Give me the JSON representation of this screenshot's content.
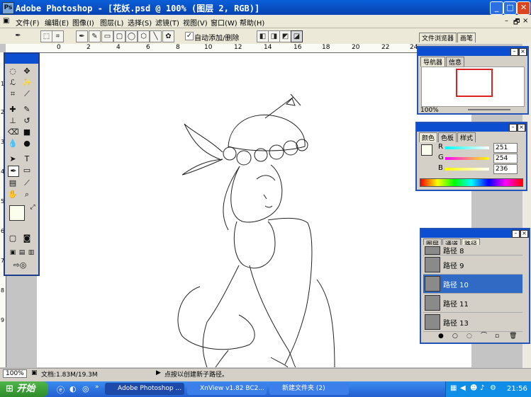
{
  "window": {
    "title": "Adobe Photoshop - [花妖.psd @ 100% (图层 2, RGB)]"
  },
  "menu": [
    "文件(F)",
    "编辑(E)",
    "图像(I)",
    "图层(L)",
    "选择(S)",
    "滤镜(T)",
    "视图(V)",
    "窗口(W)",
    "帮助(H)"
  ],
  "options": {
    "auto_add_delete": "自动添加/删除",
    "palette_tabs": [
      "文件浏览器",
      "画笔"
    ]
  },
  "ruler_ticks": [
    "0",
    "2",
    "4",
    "6",
    "8",
    "10",
    "12",
    "14",
    "16",
    "18",
    "20",
    "22",
    "24"
  ],
  "ruler_v_ticks": [
    "1",
    "2",
    "3",
    "4",
    "5",
    "6",
    "7",
    "8",
    "9"
  ],
  "navigator": {
    "tabs": [
      "导航器",
      "信息"
    ],
    "zoom": "100%"
  },
  "color_panel": {
    "tabs": [
      "颜色",
      "色板",
      "样式"
    ],
    "channels": [
      {
        "label": "R",
        "value": "251"
      },
      {
        "label": "G",
        "value": "254"
      },
      {
        "label": "B",
        "value": "236"
      }
    ]
  },
  "paths_panel": {
    "tabs": [
      "图层",
      "通道",
      "路径"
    ],
    "items": [
      {
        "label": "路径 8",
        "selected": false
      },
      {
        "label": "路径 9",
        "selected": false
      },
      {
        "label": "路径 10",
        "selected": true
      },
      {
        "label": "路径 11",
        "selected": false
      },
      {
        "label": "路径 13",
        "selected": false
      }
    ]
  },
  "status": {
    "zoom": "100%",
    "doc": "文档:1.83M/19.3M",
    "hint": "点按以创建新子路径。"
  },
  "taskbar": {
    "start": "开始",
    "tasks": [
      {
        "label": "Adobe Photoshop ...",
        "active": true
      },
      {
        "label": "XnView v1.82 BC2...",
        "active": false
      },
      {
        "label": "新建文件夹 (2)",
        "active": false
      }
    ],
    "clock": "21:56"
  },
  "colors": {
    "foreground": "#fbfeec",
    "title_blue": "#0a5fd8",
    "selection": "#316ac5"
  }
}
